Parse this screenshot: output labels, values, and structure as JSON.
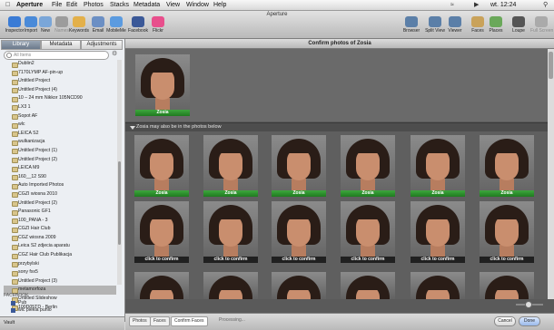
{
  "menubar": {
    "apple": "",
    "app": "Aperture",
    "items": [
      "File",
      "Edit",
      "Photos",
      "Stacks",
      "Metadata",
      "View",
      "Window",
      "Help"
    ],
    "clock": "wt. 12:24"
  },
  "toolbar": {
    "window_title": "Aperture",
    "left": [
      {
        "label": "Inspector",
        "icon": "info-icon",
        "color": "#3a7bd5"
      },
      {
        "label": "Import",
        "icon": "import-icon",
        "color": "#4a8ad8"
      },
      {
        "label": "New",
        "icon": "new-icon",
        "color": "#7aa6d8"
      },
      {
        "label": "Names",
        "icon": "names-icon",
        "color": "#9c9c9c",
        "dim": true
      },
      {
        "label": "Keywords",
        "icon": "keywords-icon",
        "color": "#e3b04a"
      },
      {
        "label": "Email",
        "icon": "email-icon",
        "color": "#6b8fc4"
      },
      {
        "label": "MobileMe",
        "icon": "mobileme-icon",
        "color": "#5b9be0"
      },
      {
        "label": "Facebook",
        "icon": "facebook-icon",
        "color": "#3b5998"
      },
      {
        "label": "Flickr",
        "icon": "flickr-icon",
        "color": "#e84f8c"
      }
    ],
    "right": [
      {
        "label": "Browser",
        "icon": "browser-icon",
        "color": "#5b7fa8"
      },
      {
        "label": "Split View",
        "icon": "split-view-icon",
        "color": "#5b7fa8"
      },
      {
        "label": "Viewer",
        "icon": "viewer-icon",
        "color": "#5b7fa8"
      },
      {
        "label": "Faces",
        "icon": "faces-icon",
        "color": "#c9a25a"
      },
      {
        "label": "Places",
        "icon": "places-icon",
        "color": "#6aa85a"
      },
      {
        "label": "Loupe",
        "icon": "loupe-icon",
        "color": "#555555"
      },
      {
        "label": "Full Screen",
        "icon": "full-screen-icon",
        "color": "#aaaaaa",
        "dim": true
      }
    ]
  },
  "sidebar": {
    "tabs": [
      "Library",
      "Metadata",
      "Adjustments"
    ],
    "active_tab": 0,
    "search_placeholder": "All Items",
    "projects": [
      "Dublin2",
      "7170LYMP AF-pin-up",
      "Untitled Project",
      "Untitled Project (4)",
      "10 – 24 mm Nikkor 105NCD90",
      "LX3 1",
      "Sopot AF",
      "wlc",
      "LEICA S2",
      "wulkanizacja",
      "Untitled Project (1)",
      "Untitled Project (2)",
      "LEICA M9",
      "160__12 S90",
      "Auto Imported Photos",
      "CGZI wiosna 2010",
      "Untitled Project (2)",
      "Panasonic GF1",
      "100_PANA - 3",
      "CGZI Hair Club",
      "CGZ wiosna 2009",
      "Leica S2 zdjecia aparatu",
      "CGZ Hair Club Publikacja",
      "przybylski",
      "sony fxx5",
      "Untitled Project (3)",
      "metamorfoza",
      "Untitled Slideshow",
      "100D05TD - Berlin"
    ],
    "selected_project": 26,
    "facebook_header": "FACEBOOK",
    "facebook_items": [
      "Pub",
      "wlc piekla punio"
    ],
    "vault_label": "Vault"
  },
  "main": {
    "title": "Confirm photos of Zosia",
    "confirmed": [
      {
        "caption": "Zosia",
        "style": "green"
      }
    ],
    "maybe_label": "Zosia may also be in the photos below",
    "grid": [
      {
        "caption": "Zosia",
        "style": "green"
      },
      {
        "caption": "Zosia",
        "style": "green"
      },
      {
        "caption": "Zosia",
        "style": "green"
      },
      {
        "caption": "Zosia",
        "style": "green"
      },
      {
        "caption": "Zosia",
        "style": "green"
      },
      {
        "caption": "Zosia",
        "style": "green"
      },
      {
        "caption": "click to confirm",
        "style": "dark"
      },
      {
        "caption": "click to confirm",
        "style": "dark"
      },
      {
        "caption": "click to confirm",
        "style": "dark"
      },
      {
        "caption": "click to confirm",
        "style": "dark"
      },
      {
        "caption": "click to confirm",
        "style": "dark"
      },
      {
        "caption": "click to confirm",
        "style": "dark"
      },
      {
        "caption": "",
        "style": "none"
      },
      {
        "caption": "",
        "style": "none"
      },
      {
        "caption": "",
        "style": "none"
      },
      {
        "caption": "",
        "style": "none"
      },
      {
        "caption": "",
        "style": "none"
      },
      {
        "caption": "",
        "style": "none"
      }
    ]
  },
  "bottombar": {
    "tabs": [
      "Photos",
      "Faces",
      "Confirm Faces"
    ],
    "active_tab": 2,
    "processing": "Processing...",
    "cancel": "Cancel",
    "done": "Done"
  }
}
